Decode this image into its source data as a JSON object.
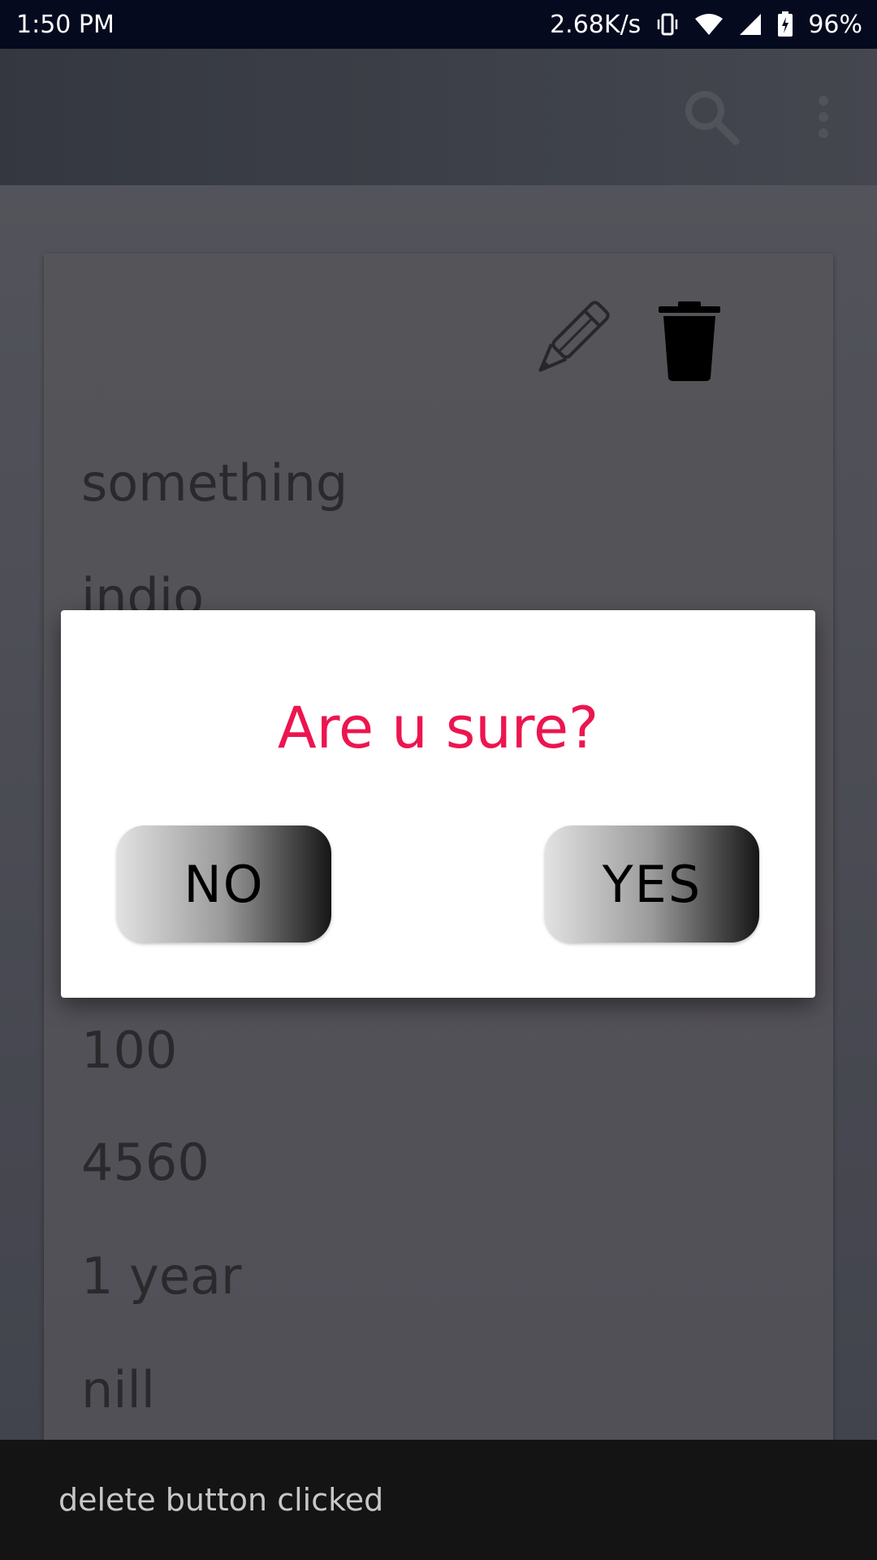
{
  "status_bar": {
    "time": "1:50 PM",
    "network_speed": "2.68K/s",
    "battery": "96%",
    "icons": [
      "vibrate-icon",
      "wifi-icon",
      "signal-icon",
      "battery-charging-icon"
    ]
  },
  "app_bar": {
    "icons": [
      "search-icon",
      "more-vert-icon"
    ]
  },
  "card": {
    "icons": [
      "pencil-icon",
      "trash-icon"
    ],
    "fields": [
      "something",
      "indio",
      "100",
      "4560",
      "1 year",
      "nill"
    ]
  },
  "dialog": {
    "title": "Are u sure?",
    "no_label": "NO",
    "yes_label": "YES"
  },
  "snackbar": {
    "message": "delete button clicked"
  },
  "colors": {
    "dialog_title": "#ec1550",
    "status_bar_bg": "#050a1f",
    "snackbar_bg": "#141414"
  }
}
